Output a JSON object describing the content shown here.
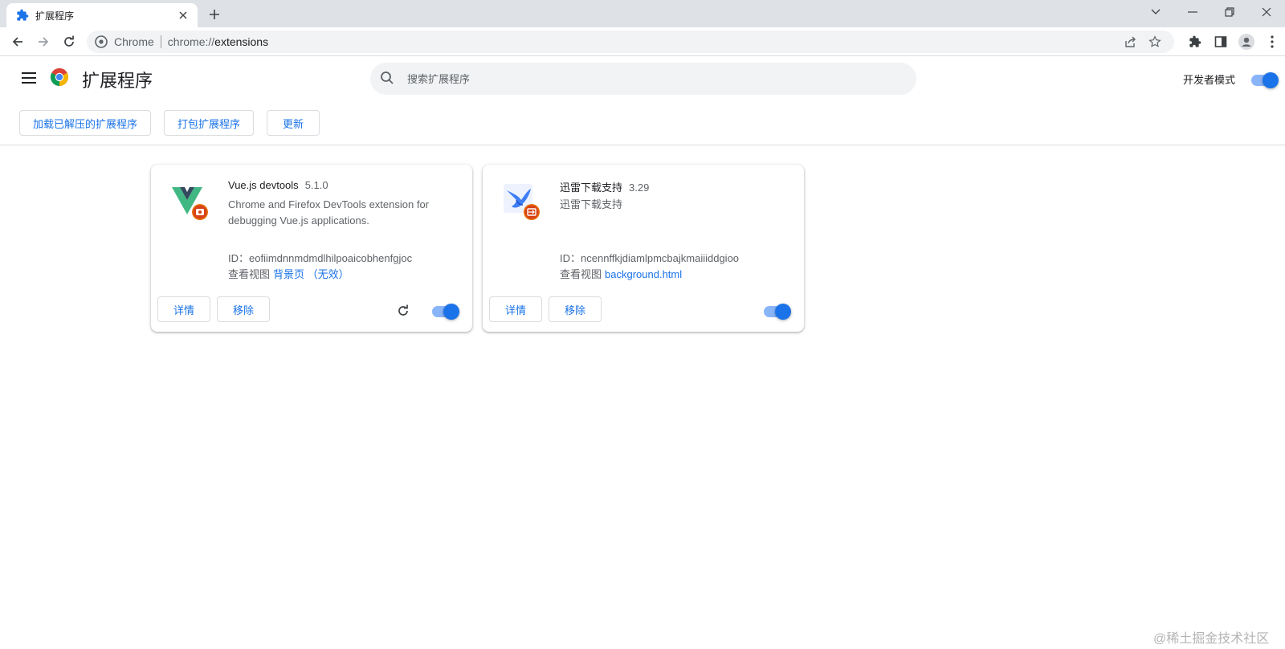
{
  "colors": {
    "accent": "#1a73e8",
    "accent_light": "#8ab4f8",
    "tabstrip": "#dee1e6",
    "omnibox": "#f1f3f4"
  },
  "tab": {
    "title": "扩展程序",
    "icon": "puzzle-icon"
  },
  "omnibox": {
    "site_label": "Chrome",
    "url_prefix": "chrome://",
    "url_path": "extensions"
  },
  "header": {
    "title": "扩展程序",
    "search_placeholder": "搜索扩展程序",
    "dev_mode_label": "开发者模式",
    "dev_mode_on": true
  },
  "dev_toolbar": {
    "load_unpacked": "加载已解压的扩展程序",
    "pack": "打包扩展程序",
    "update": "更新"
  },
  "extensions": [
    {
      "name": "Vue.js devtools",
      "version": "5.1.0",
      "description": "Chrome and Firefox DevTools extension for debugging Vue.js applications.",
      "id_line": "ID：eofiimdnnmdmdlhilpoaicobhenfgjoc",
      "views_label": "查看视图",
      "view_link": "背景页 （无效）",
      "details_label": "详情",
      "remove_label": "移除",
      "enabled": true,
      "icon": "vue-logo-icon"
    },
    {
      "name": "迅雷下载支持",
      "version": "3.29",
      "description": "迅雷下载支持",
      "id_line": "ID：ncennffkjdiamlpmcbajkmaiiiddgioo",
      "views_label": "查看视图",
      "view_link": "background.html",
      "details_label": "详情",
      "remove_label": "移除",
      "enabled": true,
      "icon": "thunder-bird-icon"
    }
  ],
  "watermark": "@稀土掘金技术社区"
}
